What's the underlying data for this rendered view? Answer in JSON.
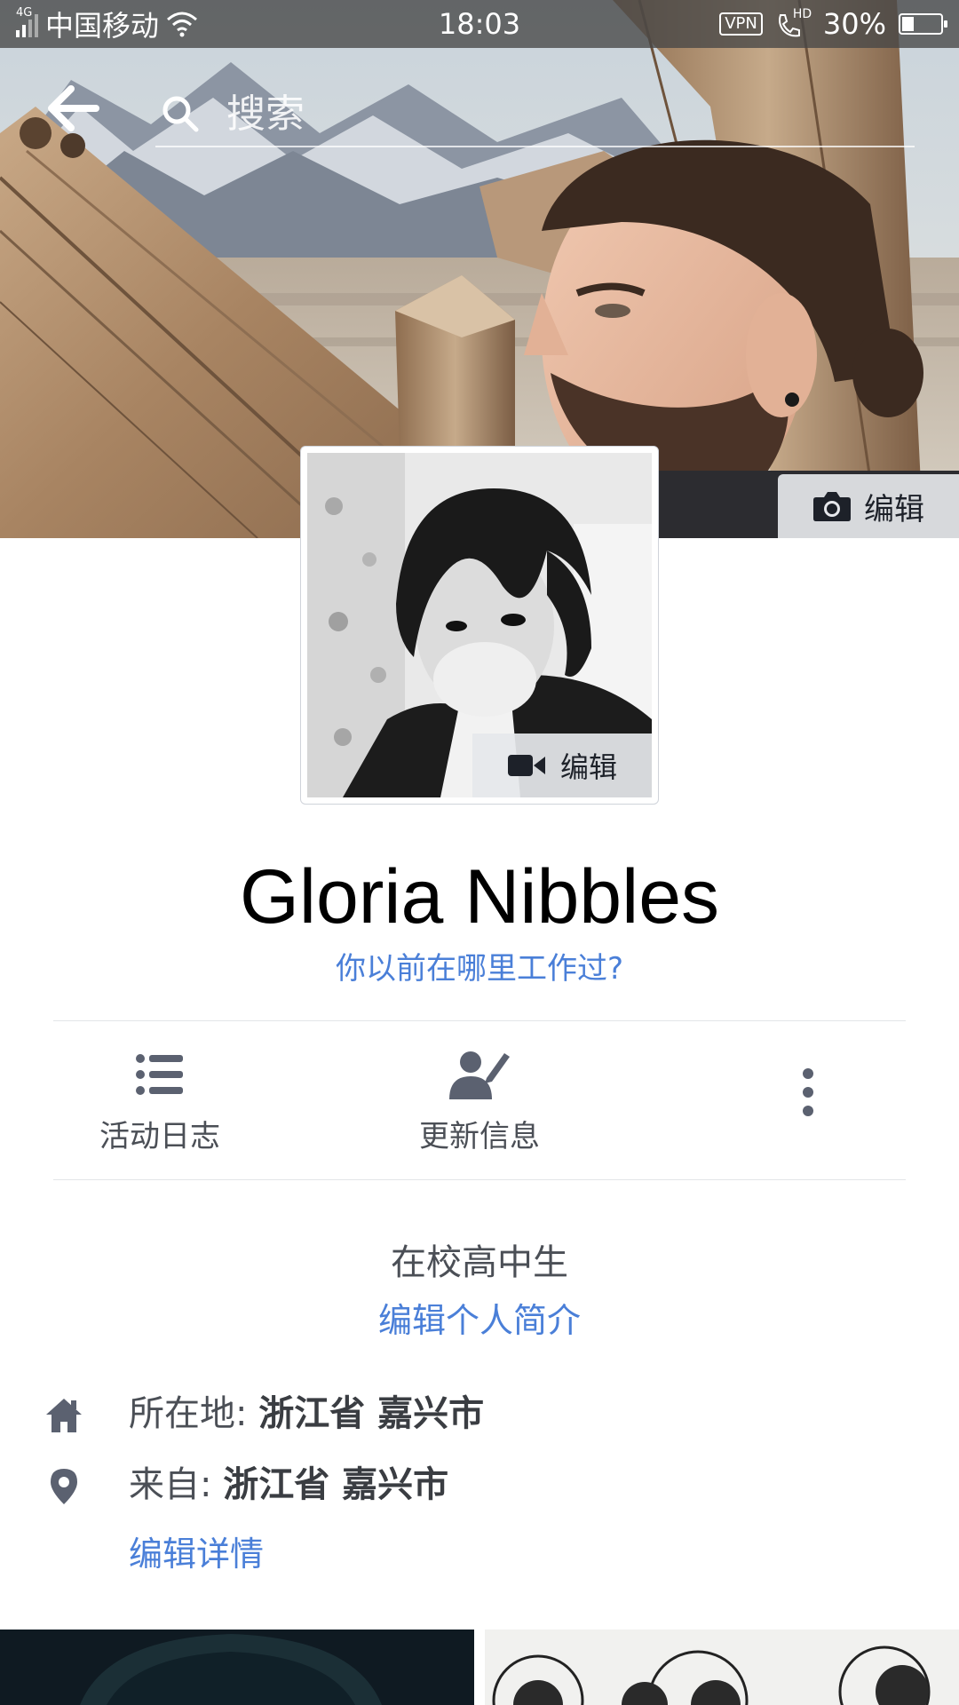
{
  "status_bar": {
    "network": "4G",
    "carrier": "中国移动",
    "time": "18:03",
    "vpn": "VPN",
    "hd": "HD",
    "battery": "30%",
    "battery_level": 0.3
  },
  "search": {
    "placeholder": "搜索"
  },
  "cover": {
    "edit_label": "编辑"
  },
  "profile_picture": {
    "edit_label": "编辑"
  },
  "profile": {
    "name": "Gloria Nibbles",
    "work_prompt": "你以前在哪里工作过?"
  },
  "actions": [
    {
      "label": "活动日志",
      "icon": "list-icon"
    },
    {
      "label": "更新信息",
      "icon": "edit-profile-icon"
    },
    {
      "label": "",
      "icon": "more-vertical-icon"
    }
  ],
  "bio": {
    "text": "在校高中生",
    "edit_label": "编辑个人简介"
  },
  "details": {
    "location_label": "所在地:",
    "location_value": "浙江省 嘉兴市",
    "from_label": "来自:",
    "from_value": "浙江省 嘉兴市",
    "edit_label": "编辑详情"
  },
  "colors": {
    "link": "#4a7fd8",
    "text": "#4b4f56",
    "icon": "#5b6170"
  }
}
